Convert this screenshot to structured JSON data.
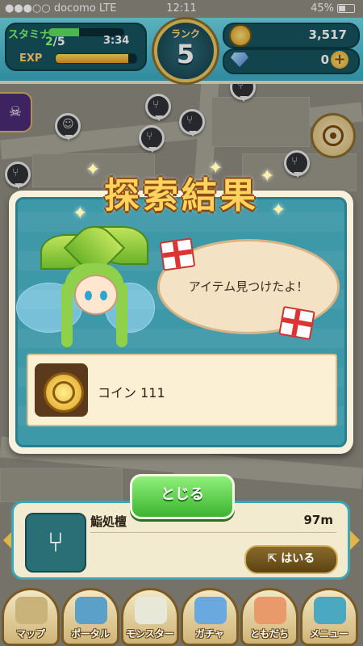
{
  "status_bar": {
    "carrier": "●●●○○ docomo  LTE",
    "time": "12:11",
    "battery": "45%"
  },
  "hud": {
    "stamina_label": "スタミナ",
    "stamina_current": "2",
    "stamina_max": "/5",
    "stamina_fraction": 0.4,
    "stamina_timer": "3:34",
    "exp_label": "EXP",
    "exp_fraction": 0.9,
    "rank_label": "ランク",
    "rank_value": "5",
    "coins": "3,517",
    "gems": "0",
    "plus": "+"
  },
  "dialog": {
    "title": "探索結果",
    "speech": "アイテム見つけたよ！",
    "item_label": "コイン 111",
    "close_label": "とじる"
  },
  "location": {
    "name": "鮨処檀",
    "distance": "97m",
    "enter_label": "はいる"
  },
  "nav": {
    "items": [
      {
        "label": "マップ",
        "color": "#c9b37a"
      },
      {
        "label": "ポータル",
        "color": "#5aa0c8"
      },
      {
        "label": "モンスター",
        "color": "#e8e8d8"
      },
      {
        "label": "ガチャ",
        "color": "#6aa8e0"
      },
      {
        "label": "ともだち",
        "color": "#e89a6a"
      },
      {
        "label": "メニュー",
        "color": "#4aa8c0"
      }
    ]
  },
  "colors": {
    "accent": "#3d98a8",
    "title_gold": "#ffd35e",
    "button_green": "#3cb431"
  }
}
